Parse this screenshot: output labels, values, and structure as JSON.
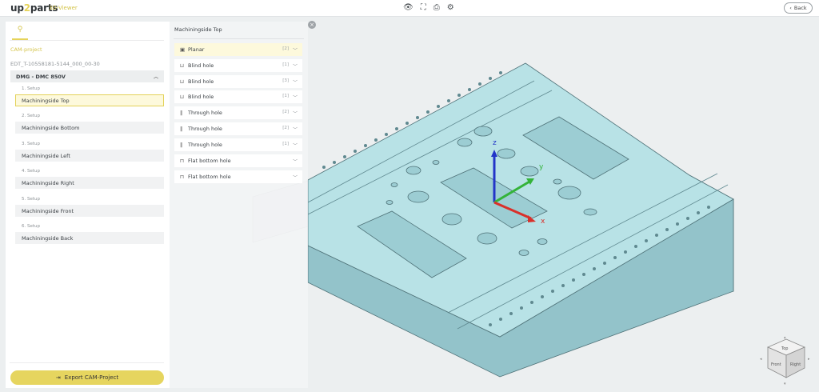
{
  "header": {
    "logo_main": "up",
    "logo_two": "2",
    "logo_tail": "parts",
    "subtitle": "3D-Viewer",
    "back_label": "Back",
    "icons": [
      "eye-icon",
      "expand-icon",
      "print-icon",
      "settings-icon"
    ]
  },
  "left": {
    "tab_icon": "pin-icon",
    "cam_project": "CAM-project",
    "edt": "EDT_T-10558181-5144_000_00-30",
    "machine": "DMG - DMC 850V",
    "setups": [
      {
        "cap": "1. Setup",
        "name": "Machiningside Top"
      },
      {
        "cap": "2. Setup",
        "name": "Machiningside Bottom"
      },
      {
        "cap": "3. Setup",
        "name": "Machiningside Left"
      },
      {
        "cap": "4. Setup",
        "name": "Machiningside Right"
      },
      {
        "cap": "5. Setup",
        "name": "Machiningside Front"
      },
      {
        "cap": "6. Setup",
        "name": "Machiningside Back"
      }
    ],
    "export_label": "Export CAM-Project"
  },
  "features": {
    "title": "Machiningside Top",
    "items": [
      {
        "icon": "planar-icon",
        "label": "Planar",
        "count": "[2]"
      },
      {
        "icon": "blind-hole-icon",
        "label": "Blind hole",
        "count": "[1]"
      },
      {
        "icon": "blind-hole-icon",
        "label": "Blind hole",
        "count": "[3]"
      },
      {
        "icon": "blind-hole-icon",
        "label": "Blind hole",
        "count": "[1]"
      },
      {
        "icon": "through-hole-icon",
        "label": "Through hole",
        "count": "[2]"
      },
      {
        "icon": "through-hole-icon",
        "label": "Through hole",
        "count": "[2]"
      },
      {
        "icon": "through-hole-icon",
        "label": "Through hole",
        "count": "[1]"
      },
      {
        "icon": "flat-bottom-icon",
        "label": "Flat bottom hole",
        "count": ""
      },
      {
        "icon": "flat-bottom-icon",
        "label": "Flat bottom hole",
        "count": ""
      }
    ]
  },
  "nav_cube": {
    "top": "Top",
    "front": "Front",
    "right": "Right"
  },
  "colors": {
    "accent": "#e6d55f",
    "model": "#a9d7dc",
    "axis_x": "#d9302a",
    "axis_y": "#34b33a",
    "axis_z": "#2335c8"
  }
}
